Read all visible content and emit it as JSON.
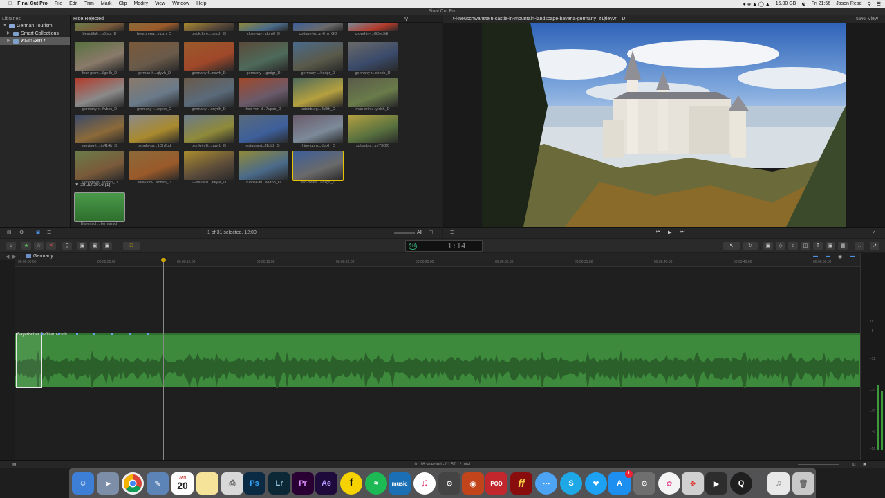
{
  "menubar": {
    "app": "Final Cut Pro",
    "items": [
      "File",
      "Edit",
      "Trim",
      "Mark",
      "Clip",
      "Modify",
      "View",
      "Window",
      "Help"
    ],
    "disk": "15.80 GB",
    "clock": "Fri 21:56",
    "user": "Jason Read"
  },
  "window": {
    "title": "Final Cut Pro"
  },
  "libraries": {
    "header": "Libraries",
    "items": [
      {
        "label": "German Tourism"
      },
      {
        "label": "Smart Collections"
      },
      {
        "label": "20-01-2017"
      }
    ]
  },
  "browser": {
    "filter": "Hide Rejected",
    "clips": [
      {
        "caption": "beautiful-...u8pxs_D"
      },
      {
        "caption": "beuron-pa...ytpzh_D"
      },
      {
        "caption": "black-fore...zpsxh_D"
      },
      {
        "caption": "close-up-...dorp0_D"
      },
      {
        "caption": "cottage-in...zy6_n_GD"
      },
      {
        "caption": "crowd-in-...G2ec9dl_"
      },
      {
        "caption": "four-germ...5gx-lb_D"
      },
      {
        "caption": "german-h...qfyvh_D"
      },
      {
        "caption": "germany-f...nowh_D"
      },
      {
        "caption": "germany-...godgr_D"
      },
      {
        "caption": "germany-...hddgr_D"
      },
      {
        "caption": "germany-r...xbexh_D"
      },
      {
        "caption": "germany-r...fwbcx_D"
      },
      {
        "caption": "germany-r...rdpxb_D"
      },
      {
        "caption": "germany-...xnydh_D"
      },
      {
        "caption": "hex-von-d...7upxb_D"
      },
      {
        "caption": "ladenburg...4k8th_D"
      },
      {
        "caption": "man-drink...ytdxh_D"
      },
      {
        "caption": "moving-tr...jo414b_D"
      },
      {
        "caption": "people-sa...1Oh2bd"
      },
      {
        "caption": "plonlein-lit...ngyrb_D"
      },
      {
        "caption": "restaurant...f1gL2_G_"
      },
      {
        "caption": "rhine-gorg...dufxh_D"
      },
      {
        "caption": "schonbur...ysY3Of0"
      },
      {
        "caption": "signage-in...lpzfgb_D"
      },
      {
        "caption": "snow-cov...xobxb_D"
      },
      {
        "caption": "t-l-neusch...jtleyvr_D"
      },
      {
        "caption": "t-lapse-m...wl-rop_D"
      },
      {
        "caption": "two-pears...u8xgb_D"
      }
    ],
    "group2": {
      "label": "28 Jul 2016",
      "count": "(1)"
    },
    "audio_clip": {
      "caption": "Bayerisch...liermarsch"
    },
    "footer": {
      "selection": "1 of 31 selected, 12:00",
      "all_label": "All"
    }
  },
  "viewer": {
    "title": "t-l-neuschwanstein-castle-in-mountain-landscape-bavaria-germany_z1jtleyvr__D",
    "zoom": "55%",
    "view_label": "View"
  },
  "toolbar": {
    "timecode": "1:14",
    "tc_badge": "100"
  },
  "timeline": {
    "project": "Germany",
    "ruler": [
      "00:00:00:00",
      "00:00:05:00",
      "00:00:10:00",
      "00:00:15:00",
      "00:00:20:00",
      "00:00:25:00",
      "00:00:30:00",
      "00:00:35:00",
      "00:00:40:00",
      "00:00:45:00",
      "00:00:50:00"
    ],
    "clip_label": "Bayerischer Defiliermarsch"
  },
  "meters": {
    "labels": [
      "0",
      "-6",
      "-12",
      "-20",
      "-30",
      "-40",
      "-50"
    ]
  },
  "status": {
    "text": "01:16 selected - 01:57:12 total"
  },
  "dock": {
    "ps": "Ps",
    "lr": "Lr",
    "pr": "Pr",
    "ae": "Ae",
    "f": "f",
    "music": "music",
    "cal": "20",
    "cal_month": "JAN",
    "ff": "ff",
    "pod": "POD",
    "badge": "1"
  },
  "colors": {
    "accent": "#e8c400",
    "audio_green": "#3f8f3f",
    "selection": "#5a5a5a"
  }
}
